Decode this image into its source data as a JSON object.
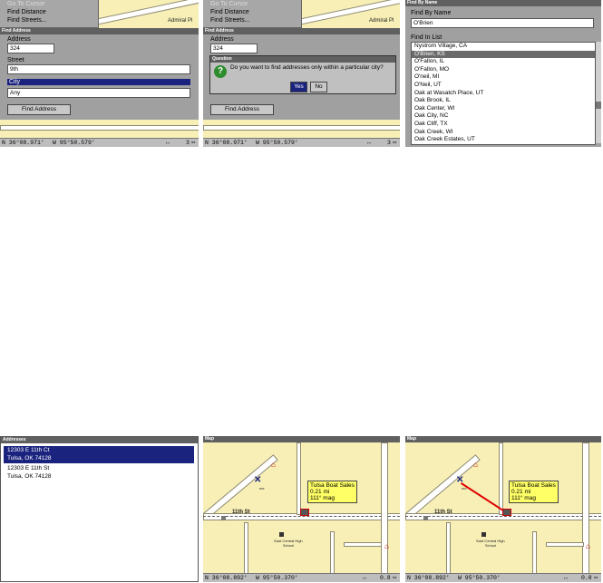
{
  "panel1": {
    "menu_items": [
      "Go To Cursor",
      "Find Distance",
      "Find Streets..."
    ],
    "map_label": "Admiral Pl",
    "dialog_title": "Find Address",
    "address_label": "Address",
    "address_value": "324",
    "street_label": "Street",
    "street_value": "9th",
    "city_label": "City",
    "city_value": "Any",
    "find_button": "Find Address",
    "status": {
      "lat": "N  36°08.971'",
      "lon": "W  95°50.579'",
      "zoom": "3",
      "zoom_unit": "mi"
    }
  },
  "panel2": {
    "menu_items": [
      "Go To Cursor",
      "Find Distance",
      "Find Streets..."
    ],
    "map_label": "Admiral Pl",
    "dialog_title": "Find Address",
    "address_label": "Address",
    "address_value": "324",
    "question_title": "Question",
    "question_text": "Do you want to find addresses only within a particular city?",
    "yes": "Yes",
    "no": "No",
    "find_button": "Find Address",
    "status": {
      "lat": "N  36°08.971'",
      "lon": "W  95°50.579'",
      "zoom": "3",
      "zoom_unit": "mi"
    }
  },
  "panel3": {
    "title": "Find By Name",
    "find_label": "Find By Name",
    "search_value": "O'Brien",
    "list_label": "Find In List",
    "items": [
      "Nystrom Village, CA",
      "O'Brien, KS",
      "O'Fallon, IL",
      "O'Fallon, MO",
      "O'neil, MI",
      "O'Neil, UT",
      "Oak at Wasatch Place, UT",
      "Oak Brook, IL",
      "Oak Center, WI",
      "Oak City, NC",
      "Oak Cliff, TX",
      "Oak Creek, WI",
      "Oak Creek Estates, UT"
    ],
    "selected_index": 1
  },
  "panel4": {
    "title": "Addresses",
    "results": [
      {
        "line1": "12303 E 11th Ct",
        "line2": "Tulsa, OK  74128"
      },
      {
        "line1": "12303 E 11th St",
        "line2": "Tulsa, OK  74128"
      }
    ]
  },
  "panel5": {
    "title": "Map",
    "callout": [
      "Tulsa Boat Sales",
      "0.21 mi",
      "111° mag"
    ],
    "street": "11th St",
    "school": "East Central High School",
    "me_label": "me",
    "status": {
      "lat": "N  36°08.892'",
      "lon": "W  95°50.370'",
      "zoom": "0.8",
      "zoom_unit": "mi"
    }
  },
  "panel6": {
    "title": "Map",
    "callout": [
      "Tulsa Boat Sales",
      "0.21 mi",
      "111° mag"
    ],
    "street": "11th St",
    "school": "East Central High School",
    "me_label": "me",
    "status": {
      "lat": "N  36°08.892'",
      "lon": "W  95°50.370'",
      "zoom": "0.8",
      "zoom_unit": "mi"
    }
  }
}
